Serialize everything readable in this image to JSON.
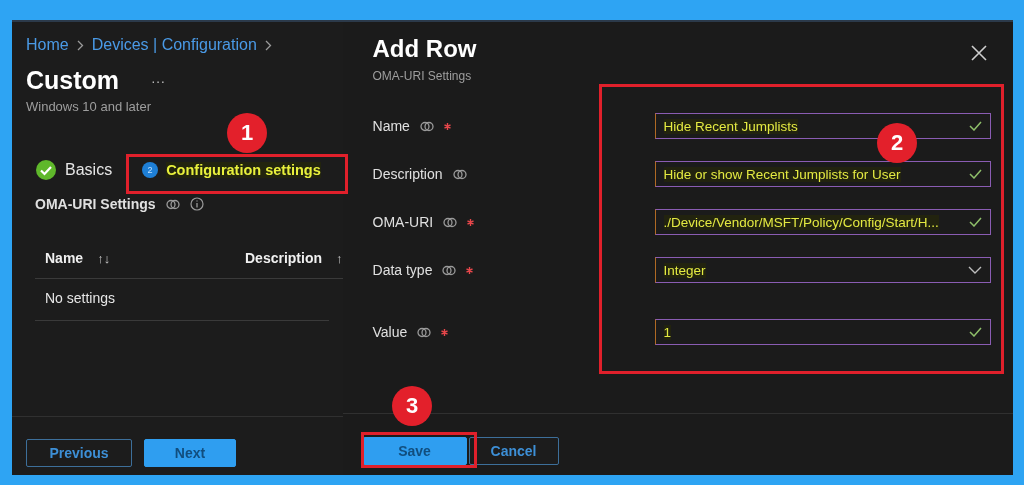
{
  "left_panel": {
    "breadcrumb": [
      "Home",
      "Devices | Configuration"
    ],
    "title": "Custom",
    "more": "···",
    "subtitle": "Windows 10 and later",
    "steps": [
      {
        "label": "Basics",
        "completed": true,
        "selected": false
      },
      {
        "number": "2",
        "label": "Configuration settings",
        "completed": false,
        "selected": true
      }
    ],
    "section_title": "OMA-URI Settings",
    "table": {
      "columns": [
        {
          "label": "Name",
          "sort": "↑↓"
        },
        {
          "label": "Description",
          "sort": "↑"
        }
      ],
      "empty_text": "No settings"
    },
    "buttons": [
      {
        "label": "Previous",
        "primary": false
      },
      {
        "label": "Next",
        "primary": true
      }
    ]
  },
  "dialog": {
    "title": "Add Row",
    "subtitle": "OMA-URI Settings",
    "fields": [
      {
        "label": "Name",
        "required": true,
        "kind": "text",
        "value": "Hide Recent Jumplists"
      },
      {
        "label": "Description",
        "required": false,
        "kind": "text",
        "value": "Hide or show Recent Jumplists for User"
      },
      {
        "label": "OMA-URI",
        "required": true,
        "kind": "text",
        "value": "./Device/Vendor/MSFT/Policy/Config/Start/H..."
      },
      {
        "label": "Data type",
        "required": true,
        "kind": "dropdown",
        "value": "Integer"
      },
      {
        "label": "Value",
        "required": true,
        "kind": "text",
        "value": "1"
      }
    ],
    "buttons": [
      {
        "label": "Save",
        "primary": true
      },
      {
        "label": "Cancel",
        "primary": false
      }
    ]
  },
  "callouts": [
    {
      "number": "1"
    },
    {
      "number": "2"
    },
    {
      "number": "3"
    }
  ]
}
